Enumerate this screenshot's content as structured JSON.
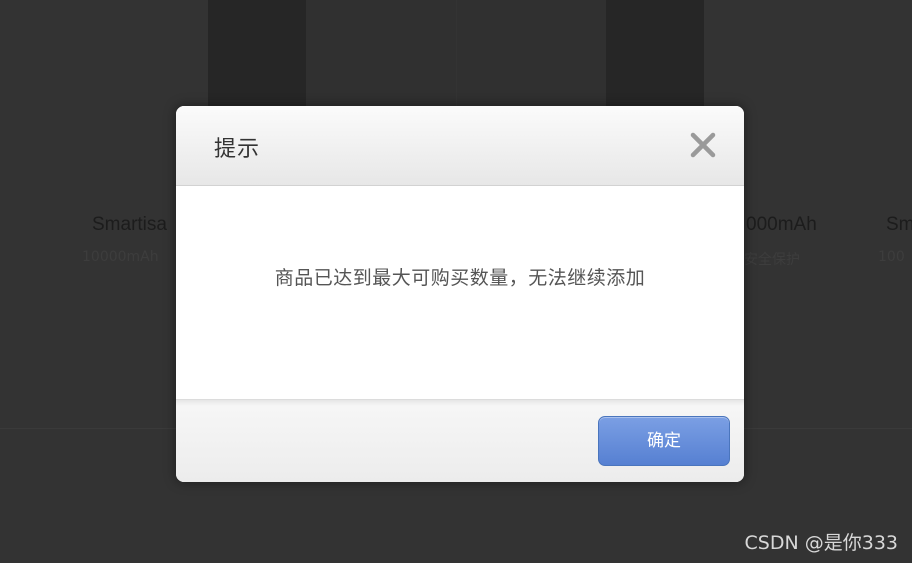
{
  "background": {
    "products": [
      {
        "title": "Smartisa",
        "subtitle": "10000mAh"
      },
      {
        "title": "000mAh",
        "subtitle": "安全保护"
      },
      {
        "title": "Sm",
        "subtitle": "100"
      }
    ]
  },
  "dialog": {
    "title": "提示",
    "close_icon": "close-icon",
    "message": "商品已达到最大可购买数量，无法继续添加",
    "confirm_label": "确定"
  },
  "colors": {
    "accent": "#5e87d8",
    "overlay": "#333333"
  },
  "watermark": "CSDN @是你333"
}
